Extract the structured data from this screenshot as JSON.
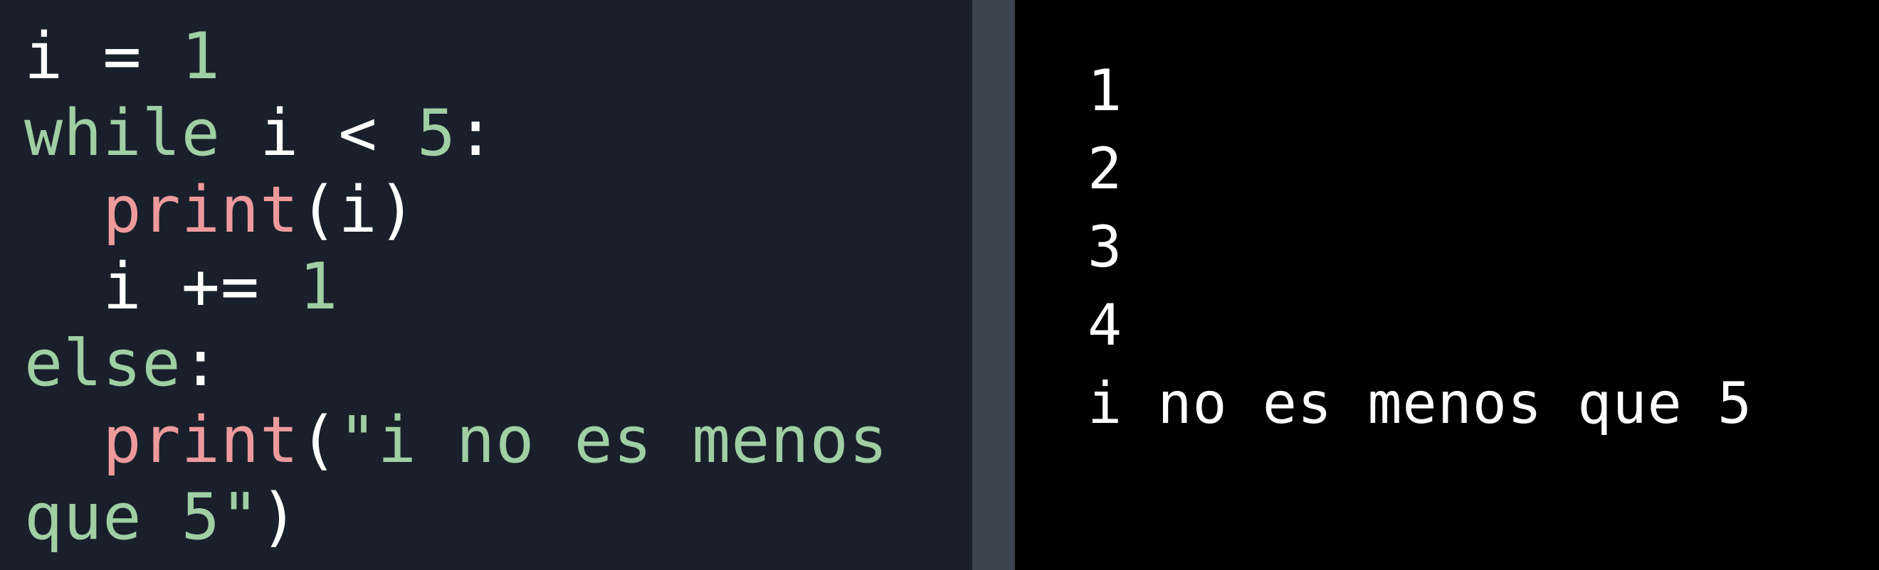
{
  "colors": {
    "editor_bg": "#1a202b",
    "divider_bg": "#3a434e",
    "console_bg": "#000000",
    "plain": "#ffffff",
    "keyword": "#9fcfa3",
    "function": "#ee9a9c",
    "number": "#9fcfa3",
    "string": "#9fcfa3"
  },
  "editor": {
    "lines": [
      [
        {
          "text": "i = ",
          "kind": "plain"
        },
        {
          "text": "1",
          "kind": "number"
        }
      ],
      [
        {
          "text": "while",
          "kind": "keyword"
        },
        {
          "text": " i < ",
          "kind": "plain"
        },
        {
          "text": "5",
          "kind": "number"
        },
        {
          "text": ":",
          "kind": "plain"
        }
      ],
      [
        {
          "text": "  ",
          "kind": "plain"
        },
        {
          "text": "print",
          "kind": "function"
        },
        {
          "text": "(i)",
          "kind": "plain"
        }
      ],
      [
        {
          "text": "  i += ",
          "kind": "plain"
        },
        {
          "text": "1",
          "kind": "number"
        }
      ],
      [
        {
          "text": "else",
          "kind": "keyword"
        },
        {
          "text": ":",
          "kind": "plain"
        }
      ],
      [
        {
          "text": "  ",
          "kind": "plain"
        },
        {
          "text": "print",
          "kind": "function"
        },
        {
          "text": "(",
          "kind": "plain"
        },
        {
          "text": "\"i no es menos",
          "kind": "string"
        }
      ],
      [
        {
          "text": "que 5\"",
          "kind": "string"
        },
        {
          "text": ")",
          "kind": "plain"
        }
      ]
    ]
  },
  "console": {
    "lines": [
      "1",
      "2",
      "3",
      "4",
      "i no es menos que 5"
    ]
  }
}
